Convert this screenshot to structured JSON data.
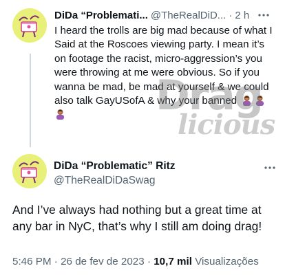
{
  "tweet1": {
    "author_name": "DiDa “Problemati...",
    "handle": "@TheRealDiD...",
    "separator": "·",
    "time": "2 h",
    "text": "I heard the trolls are big mad because of what I Said at the Roscoes viewing party. I mean it’s on footage the racist, micro-aggression’s you were throwing at me were obvious. So if you wanna be mad, be mad at yourself & we could also talk GayUSofA & why your banned",
    "emojis": [
      "person-facepalming-emoji",
      "person-facepalming-emoji",
      "person-facepalming-emoji"
    ],
    "more_icon": "more-horizontal-icon"
  },
  "watermark": {
    "line1": "Drag",
    "line2": "licious"
  },
  "tweet2": {
    "author_name": "DiDa “Problematic” Ritz",
    "handle": "@TheRealDiDaSwag",
    "text": "And I’ve always had nothing but a great time at any bar in NyC, that’s why I still am doing drag!",
    "time": "5:46 PM",
    "date": "26 de fev de 2023",
    "views_count": "10,7 mil",
    "views_label": "Visualizações",
    "separator": "·",
    "more_icon": "more-horizontal-icon"
  },
  "colors": {
    "text_primary": "#0f1419",
    "text_secondary": "#536471",
    "thread_line": "#cfd9de",
    "avatar_bg": "#e8f07a"
  }
}
